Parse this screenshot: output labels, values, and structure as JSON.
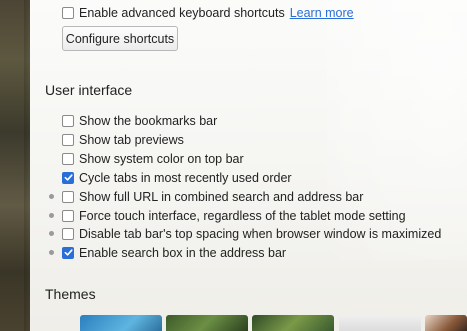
{
  "keyboard": {
    "advanced_shortcuts_label": "Enable advanced keyboard shortcuts",
    "advanced_shortcuts_checked": false,
    "learn_more_label": "Learn more",
    "configure_button_label": "Configure shortcuts"
  },
  "user_interface": {
    "heading": "User interface",
    "options": [
      {
        "label": "Show the bookmarks bar",
        "checked": false,
        "flag": false
      },
      {
        "label": "Show tab previews",
        "checked": false,
        "flag": false
      },
      {
        "label": "Show system color on top bar",
        "checked": false,
        "flag": false
      },
      {
        "label": "Cycle tabs in most recently used order",
        "checked": true,
        "flag": false
      },
      {
        "label": "Show full URL in combined search and address bar",
        "checked": false,
        "flag": true
      },
      {
        "label": "Force touch interface, regardless of the tablet mode setting",
        "checked": false,
        "flag": true
      },
      {
        "label": "Disable tab bar's top spacing when browser window is maximized",
        "checked": false,
        "flag": true
      },
      {
        "label": "Enable search box in the address bar",
        "checked": true,
        "flag": true
      }
    ]
  },
  "themes": {
    "heading": "Themes",
    "colors": {
      "thumb1": "#3a8fc4",
      "thumb2": "#5c7a3c",
      "thumb3": "#6b8a3a",
      "thumb4": "#e6e6e6",
      "thumb5": "#8a5a3a"
    }
  },
  "colors": {
    "accent": "#2a6fd8",
    "checkbox_border": "#8a8a8a"
  }
}
